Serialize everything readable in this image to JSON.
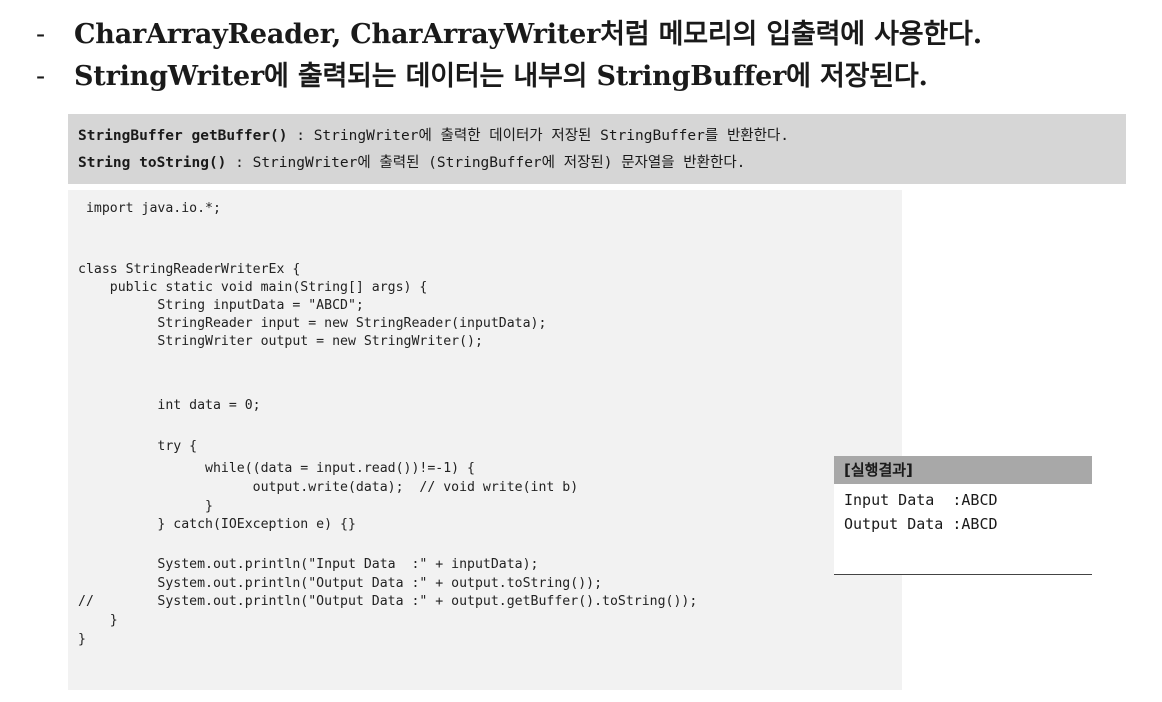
{
  "bullets": [
    {
      "dash": "-",
      "text": "CharArrayReader, CharArrayWriter처럼 메모리의 입출력에 사용한다."
    },
    {
      "dash": "-",
      "text": "StringWriter에 출력되는 데이터는 내부의 StringBuffer에 저장된다."
    }
  ],
  "api": [
    {
      "signature": "StringBuffer getBuffer()",
      "desc": " : StringWriter에 출력한 데이터가 저장된 StringBuffer를 반환한다."
    },
    {
      "signature": "String toString()",
      "desc": " : StringWriter에 출력된 (StringBuffer에 저장된) 문자열을 반환한다."
    }
  ],
  "code": [
    " import java.io.*;",
    "class StringReaderWriterEx {",
    "    public static void main(String[] args) {",
    "          String inputData = \"ABCD\";",
    "          StringReader input = new StringReader(inputData);",
    "          StringWriter output = new StringWriter();",
    "          int data = 0;",
    "          try {",
    "                while((data = input.read())!=-1) {",
    "                      output.write(data);  // void write(int b)",
    "                }",
    "          } catch(IOException e) {}",
    "          System.out.println(\"Input Data  :\" + inputData);",
    "          System.out.println(\"Output Data :\" + output.toString());",
    "//        System.out.println(\"Output Data :\" + output.getBuffer().toString());",
    "    }",
    "}"
  ],
  "result": {
    "title": "[실행결과]",
    "lines": [
      "Input Data  :ABCD",
      "Output Data :ABCD"
    ]
  }
}
